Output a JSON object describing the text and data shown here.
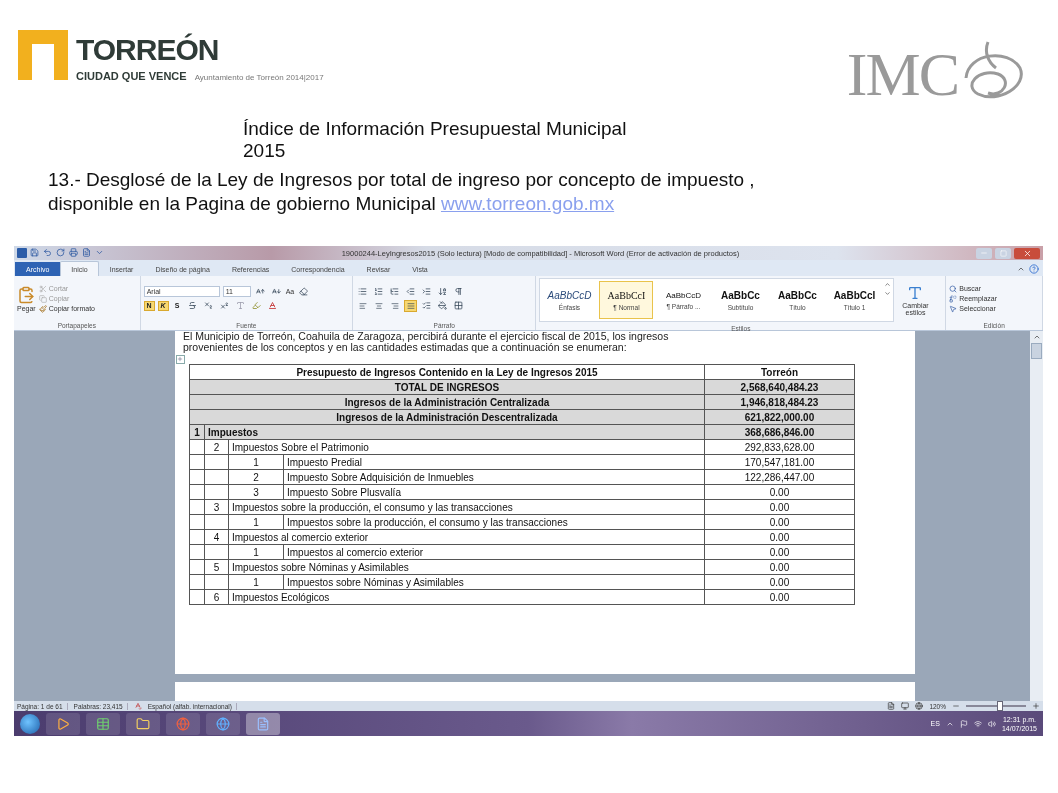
{
  "header": {
    "logo": {
      "name": "TORREÓN",
      "slogan": "CIUDAD QUE VENCE",
      "caption": "Ayuntamiento de Torreón 2014|2017"
    },
    "partner_logo": "IMC"
  },
  "title_lines": [
    "Índice de Información Presupuestal Municipal",
    "2015"
  ],
  "intro": {
    "lines": [
      "13.- Desglosé de la Ley de Ingresos por total  de ingreso por concepto de impuesto ,",
      "disponible en la Pagina de gobierno Municipal"
    ],
    "link": "www.torreon.gob.mx"
  },
  "word": {
    "title": "19000244-LeyIngresos2015 (Solo lectura) [Modo de compatibilidad] - Microsoft Word (Error de activación de productos)",
    "tabs": [
      {
        "label": "Archivo",
        "kind": "file",
        "selected": false
      },
      {
        "label": "Inicio",
        "kind": "tab",
        "selected": true
      },
      {
        "label": "Insertar",
        "kind": "tab",
        "selected": false
      },
      {
        "label": "Diseño de página",
        "kind": "tab",
        "selected": false
      },
      {
        "label": "Referencias",
        "kind": "tab",
        "selected": false
      },
      {
        "label": "Correspondencia",
        "kind": "tab",
        "selected": false
      },
      {
        "label": "Revisar",
        "kind": "tab",
        "selected": false
      },
      {
        "label": "Vista",
        "kind": "tab",
        "selected": false
      }
    ],
    "clipboard": {
      "label": "Portapapeles",
      "paste": "Pegar",
      "items": [
        {
          "label": "Cortar",
          "disabled": true
        },
        {
          "label": "Copiar",
          "disabled": true
        },
        {
          "label": "Copiar formato",
          "disabled": false
        }
      ]
    },
    "font": {
      "label": "Fuente",
      "font_name": "Arial",
      "font_size": "11",
      "case_button": "Aa",
      "format_buttons": [
        {
          "label": "N",
          "pressed": true
        },
        {
          "label": "K",
          "pressed": true
        },
        {
          "label": "S",
          "pressed": false
        }
      ]
    },
    "paragraph": {
      "label": "Párrafo",
      "alignments": [
        {
          "selected": false
        },
        {
          "selected": false
        },
        {
          "selected": false
        },
        {
          "selected": true
        }
      ]
    },
    "styles": {
      "label": "Estilos",
      "items": [
        {
          "preview": "AaBbCcD",
          "name": "Énfasis",
          "kind": "italic",
          "selected": false
        },
        {
          "preview": "AaBbCcI",
          "name": "¶ Normal",
          "kind": "serif",
          "selected": true
        },
        {
          "preview": "AaBbCcD",
          "name": "¶ Párrafo ...",
          "kind": "small",
          "selected": false
        },
        {
          "preview": "AaBbCc",
          "name": "Subtítulo",
          "kind": "bold",
          "selected": false
        },
        {
          "preview": "AaBbCc",
          "name": "Título",
          "kind": "bold",
          "selected": false
        },
        {
          "preview": "AaBbCcI",
          "name": "Título 1",
          "kind": "bold",
          "selected": false
        }
      ],
      "change": "Cambiar estilos"
    },
    "editing": {
      "label": "Edición",
      "items": [
        "Buscar",
        "Reemplazar",
        "Seleccionar"
      ]
    },
    "document": {
      "lines": [
        "El Municipio de Torreón, Coahuila de Zaragoza, percibirá durante el ejercicio fiscal de 2015, los ingresos",
        "provenientes de los conceptos y en las cantidades estimadas que a continuación se enumeran:"
      ],
      "table": {
        "header": {
          "label": "Presupuesto de Ingresos Contenido en la Ley de Ingresos 2015",
          "value": "Torreón"
        },
        "totals": [
          {
            "label": "TOTAL DE INGRESOS",
            "value": "2,568,640,484.23"
          },
          {
            "label": "Ingresos de la Administración Centralizada",
            "value": "1,946,818,484.23"
          },
          {
            "label": "Ingresos de la Administración Descentralizada",
            "value": "621,822,000.00"
          }
        ],
        "rows": [
          {
            "number": "1",
            "label": "Impuestos",
            "value": "368,686,846.00",
            "children": [
              {
                "number": "2",
                "label": "Impuestos Sobre el Patrimonio",
                "value": "292,833,628.00",
                "children": [
                  {
                    "number": "1",
                    "label": "Impuesto Predial",
                    "value": "170,547,181.00"
                  },
                  {
                    "number": "2",
                    "label": "Impuesto Sobre Adquisición de Inmuebles",
                    "value": "122,286,447.00"
                  },
                  {
                    "number": "3",
                    "label": "Impuesto Sobre Plusvalía",
                    "value": "0.00"
                  }
                ]
              },
              {
                "number": "3",
                "label": "Impuestos sobre la producción, el consumo y las transacciones",
                "value": "0.00",
                "children": [
                  {
                    "number": "1",
                    "label": "Impuestos sobre la producción, el consumo y las transacciones",
                    "value": "0.00"
                  }
                ]
              },
              {
                "number": "4",
                "label": "Impuestos al comercio exterior",
                "value": "0.00",
                "children": [
                  {
                    "number": "1",
                    "label": "Impuestos al comercio exterior",
                    "value": "0.00"
                  }
                ]
              },
              {
                "number": "5",
                "label": "Impuestos sobre Nóminas y Asimilables",
                "value": "0.00",
                "children": [
                  {
                    "number": "1",
                    "label": "Impuestos sobre Nóminas y Asimilables",
                    "value": "0.00"
                  }
                ]
              },
              {
                "number": "6",
                "label": "Impuestos Ecológicos",
                "value": "0.00"
              }
            ]
          }
        ]
      }
    },
    "status_bar": {
      "items": [
        "Página: 1 de 61",
        "Palabras: 23,415",
        "Español (alfab. internacional)"
      ],
      "zoom": "120%",
      "level": 0.55
    },
    "taskbar": {
      "language": "ES",
      "time": "12:31 p.m.",
      "date": "14/07/2015"
    }
  }
}
